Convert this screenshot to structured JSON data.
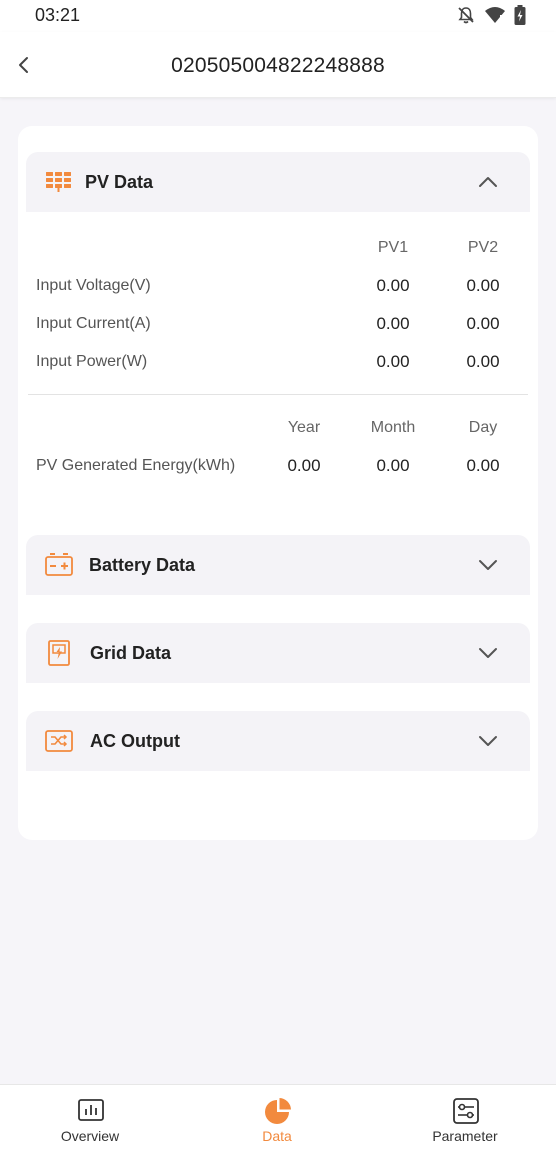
{
  "status_bar": {
    "time": "03:21",
    "icons": [
      "bell-off-icon",
      "wifi-icon",
      "battery-icon"
    ]
  },
  "header": {
    "title": "020505004822248888"
  },
  "sections": {
    "pv": {
      "title": "PV Data",
      "expanded": true,
      "columns": [
        "PV1",
        "PV2"
      ],
      "rows": [
        {
          "label": "Input Voltage(V)",
          "values": [
            "0.00",
            "0.00"
          ]
        },
        {
          "label": "Input Current(A)",
          "values": [
            "0.00",
            "0.00"
          ]
        },
        {
          "label": "Input Power(W)",
          "values": [
            "0.00",
            "0.00"
          ]
        }
      ],
      "energy": {
        "columns": [
          "Year",
          "Month",
          "Day"
        ],
        "label": "PV Generated Energy(kWh)",
        "values": [
          "0.00",
          "0.00",
          "0.00"
        ]
      }
    },
    "battery": {
      "title": "Battery Data",
      "expanded": false
    },
    "grid": {
      "title": "Grid Data",
      "expanded": false
    },
    "ac_output": {
      "title": "AC Output",
      "expanded": false
    }
  },
  "tabbar": {
    "tabs": [
      {
        "label": "Overview",
        "icon": "chart-icon",
        "active": false
      },
      {
        "label": "Data",
        "icon": "pie-chart-icon",
        "active": true
      },
      {
        "label": "Parameter",
        "icon": "sliders-icon",
        "active": false
      }
    ]
  },
  "colors": {
    "accent": "#f28a3e",
    "background": "#f6f5f9",
    "section_header": "#f4f3f7"
  }
}
